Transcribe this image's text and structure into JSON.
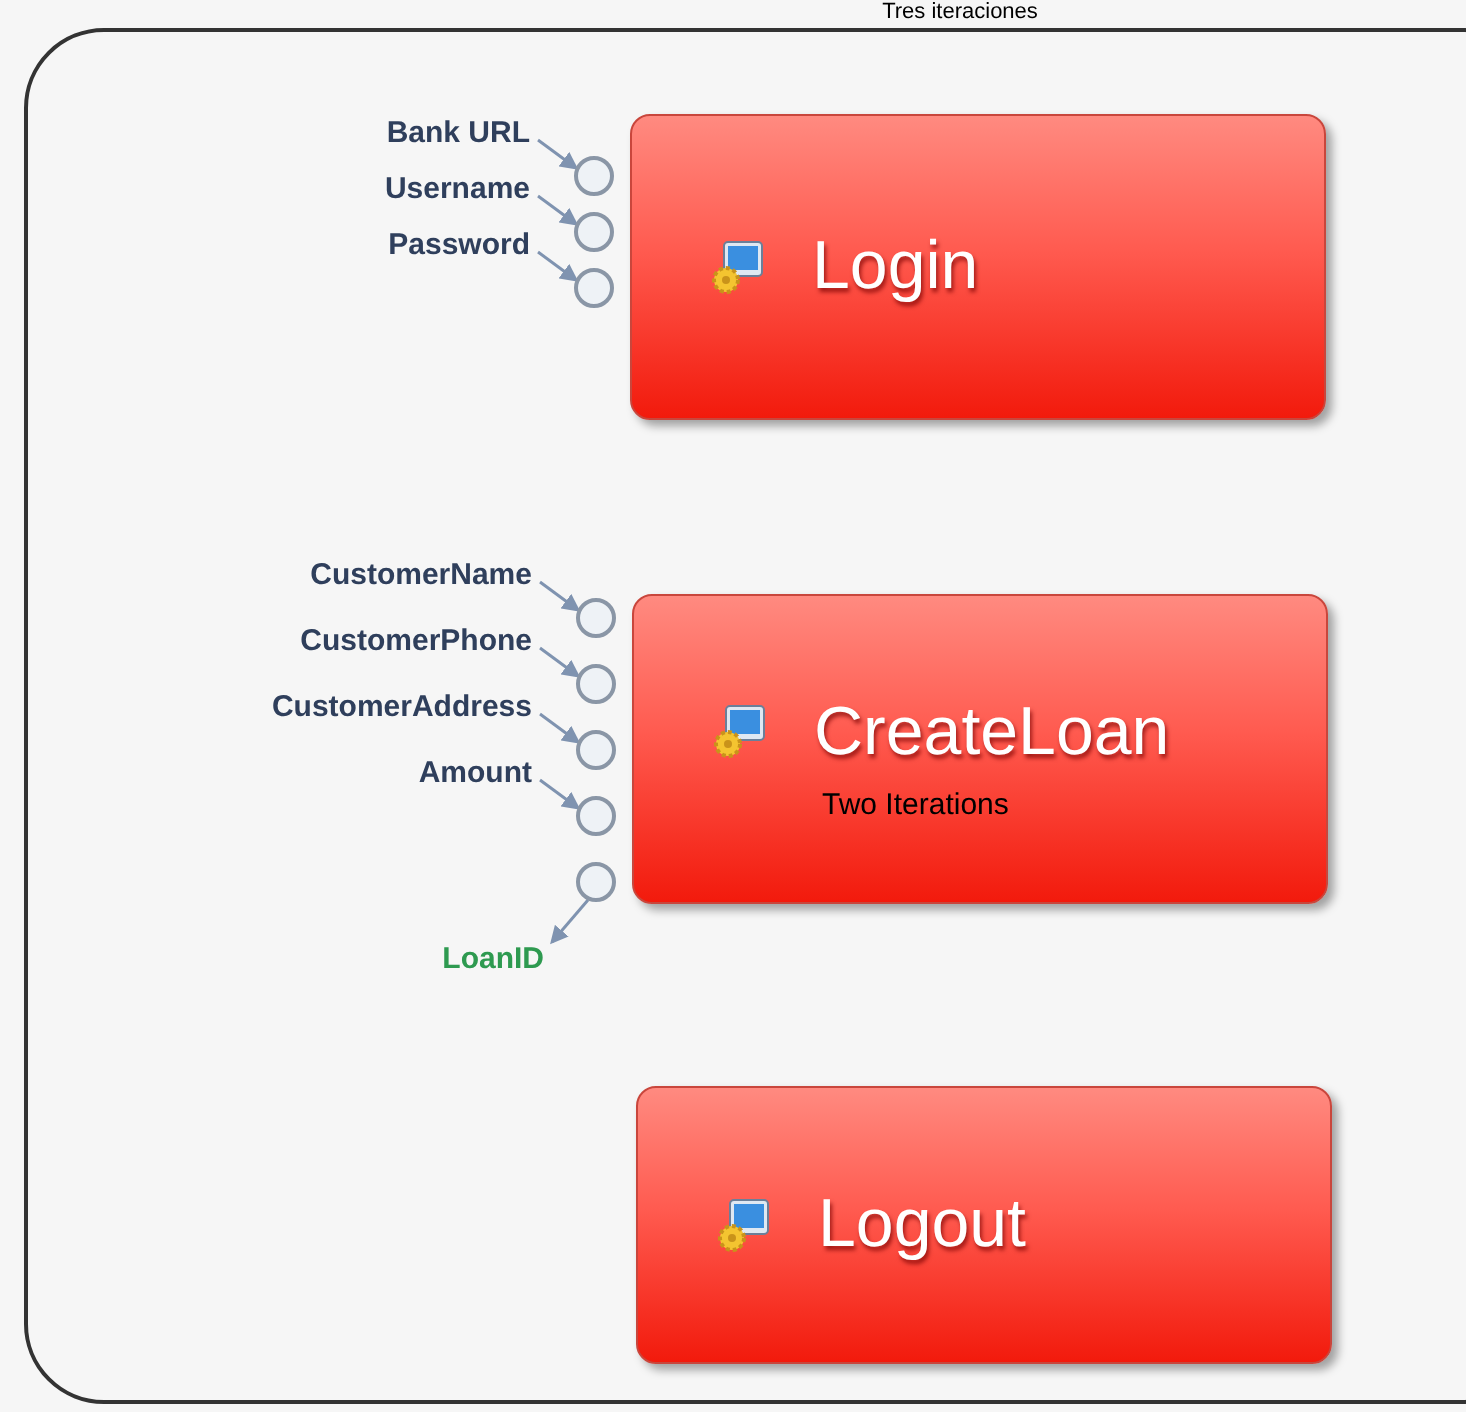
{
  "title": "Tres iteraciones",
  "operations": [
    {
      "name": "Login",
      "inputs": [
        {
          "label": "Bank URL",
          "kind": "input"
        },
        {
          "label": "Username",
          "kind": "input"
        },
        {
          "label": "Password",
          "kind": "input"
        }
      ]
    },
    {
      "name": "CreateLoan",
      "note": "Two Iterations",
      "inputs": [
        {
          "label": "CustomerName",
          "kind": "input"
        },
        {
          "label": "CustomerPhone",
          "kind": "input"
        },
        {
          "label": "CustomerAddress",
          "kind": "input"
        },
        {
          "label": "Amount",
          "kind": "input"
        },
        {
          "label": "LoanID",
          "kind": "output"
        }
      ]
    },
    {
      "name": "Logout"
    }
  ]
}
